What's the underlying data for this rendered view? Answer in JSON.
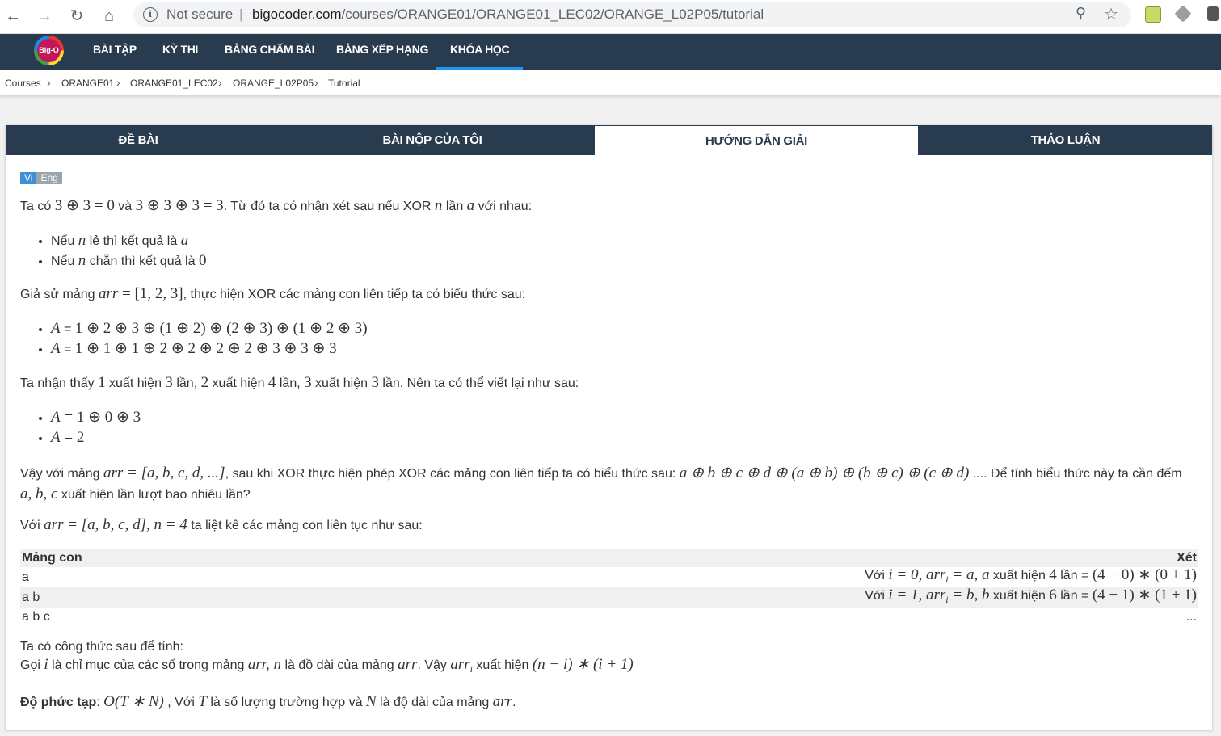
{
  "browser": {
    "security_label": "Not secure",
    "url_domain": "bigocoder.com",
    "url_path": "/courses/ORANGE01/ORANGE01_LEC02/ORANGE_L02P05/tutorial"
  },
  "navbar": {
    "logo_text": "Big-O",
    "items": [
      "BÀI TẬP",
      "KỲ THI",
      "BẢNG CHẤM BÀI",
      "BẢNG XẾP HẠNG",
      "KHÓA HỌC"
    ],
    "active": "KHÓA HỌC"
  },
  "breadcrumb": [
    "Courses",
    "ORANGE01",
    "ORANGE01_LEC02",
    "ORANGE_L02P05",
    "Tutorial"
  ],
  "tabs": {
    "items": [
      "ĐỀ BÀI",
      "BÀI NỘP CỦA TÔI",
      "HƯỚNG DẪN GIẢI",
      "THẢO LUẬN"
    ],
    "active": "HƯỚNG DẪN GIẢI"
  },
  "lang": {
    "vi": "Vi",
    "eng": "Eng"
  },
  "content": {
    "p1_a": "Ta có ",
    "p1_m1": "3 ⊕ 3 = 0",
    "p1_b": " và ",
    "p1_m2": "3 ⊕ 3 ⊕ 3 = 3",
    "p1_c": ". Từ đó ta có nhận xét sau nếu XOR ",
    "p1_n": "n",
    "p1_d": " lần ",
    "p1_a_var": "a",
    "p1_e": " với nhau:",
    "b1_a": "Nếu ",
    "b1_n": "n",
    "b1_b": " lẻ thì kết quả là ",
    "b1_c": "a",
    "b2_a": "Nếu ",
    "b2_n": "n",
    "b2_b": " chẵn thì kết quả là ",
    "b2_c": "0",
    "p2_a": "Giả sử mảng ",
    "p2_arr": "arr",
    "p2_m": " = [1, 2, 3]",
    "p2_b": ", thực hiện XOR các mảng con liên tiếp ta có biểu thức sau:",
    "e1_A": "A",
    "e1_eq": " = ",
    "e1_expr": "1 ⊕ 2 ⊕ 3 ⊕ (1 ⊕ 2) ⊕ (2 ⊕ 3) ⊕ (1 ⊕ 2 ⊕ 3)",
    "e2_A": "A",
    "e2_eq": " = ",
    "e2_expr": "1 ⊕ 1 ⊕ 1 ⊕ 2 ⊕ 2 ⊕ 2 ⊕ 2 ⊕ 3 ⊕ 3 ⊕ 3",
    "p3_a": "Ta nhận thấy ",
    "p3_1": "1",
    "p3_b": " xuất hiện ",
    "p3_3a": "3",
    "p3_c": " lần, ",
    "p3_2": "2",
    "p3_d": " xuất hiện ",
    "p3_4": "4",
    "p3_e": " lần, ",
    "p3_3b": "3",
    "p3_f": " xuất hiện ",
    "p3_3c": "3",
    "p3_g": " lần. Nên ta có thể viết lại như sau:",
    "r1_A": "A",
    "r1_expr": " = 1 ⊕ 0 ⊕ 3",
    "r2_A": "A",
    "r2_expr": " = 2",
    "p4_a": "Vậy với mảng ",
    "p4_arr": "arr",
    "p4_m": " = [a, b, c, d, ...]",
    "p4_b": ", sau khi XOR thực hiện phép XOR các mảng con liên tiếp ta có biểu thức sau: ",
    "p4_expr": "a ⊕ b ⊕ c ⊕ d ⊕ (a ⊕ b) ⊕ (b ⊕ c) ⊕ (c ⊕ d)",
    "p4_c": " .... Để tính biểu thức này ta cần đếm",
    "p4_vars": "a, b, c",
    "p4_d": " xuất hiện lần lượt bao nhiêu lần?",
    "p5_a": "Với ",
    "p5_m": "arr = [a, b, c, d], n = 4",
    "p5_b": " ta liệt kê các mảng con liên tục như sau:",
    "p6_line1": "Ta có công thức sau để tính:",
    "p6_a": "Gọi ",
    "p6_i": "i",
    "p6_b": " là chỉ mục của các số trong mảng ",
    "p6_arrn": "arr, n",
    "p6_c": " là đồ dài của mảng ",
    "p6_arr": "arr",
    "p6_d": ". Vậy ",
    "p6_arri": "arr",
    "p6_sub": "i",
    "p6_e": " xuất hiện ",
    "p6_formula": "(n − i) ∗ (i + 1)",
    "p7_label": "Độ phức tạp",
    "p7_colon": ": ",
    "p7_O": "O(T ∗ N)",
    "p7_a": " , Với ",
    "p7_T": "T",
    "p7_b": " là số lượng trường hợp và ",
    "p7_N": "N",
    "p7_c": " là độ dài của mảng ",
    "p7_arr": "arr",
    "p7_d": "."
  },
  "table": {
    "headers": [
      "Mảng con",
      "Xét"
    ],
    "rows": [
      {
        "sub": "a",
        "note_a": "Với ",
        "note_m": "i = 0, arr",
        "note_sub": "i",
        "note_m2": " = a, a",
        "note_b": " xuất hiện ",
        "note_cnt": "4",
        "note_c": " lần = ",
        "note_f": "(4 − 0) ∗ (0 + 1)"
      },
      {
        "sub": "a b",
        "note_a": "Với ",
        "note_m": "i = 1, arr",
        "note_sub": "i",
        "note_m2": " = b, b",
        "note_b": " xuất hiện ",
        "note_cnt": "6",
        "note_c": " lần = ",
        "note_f": "(4 − 1) ∗ (1 + 1)"
      },
      {
        "sub": "a b c",
        "dots": "..."
      }
    ]
  }
}
